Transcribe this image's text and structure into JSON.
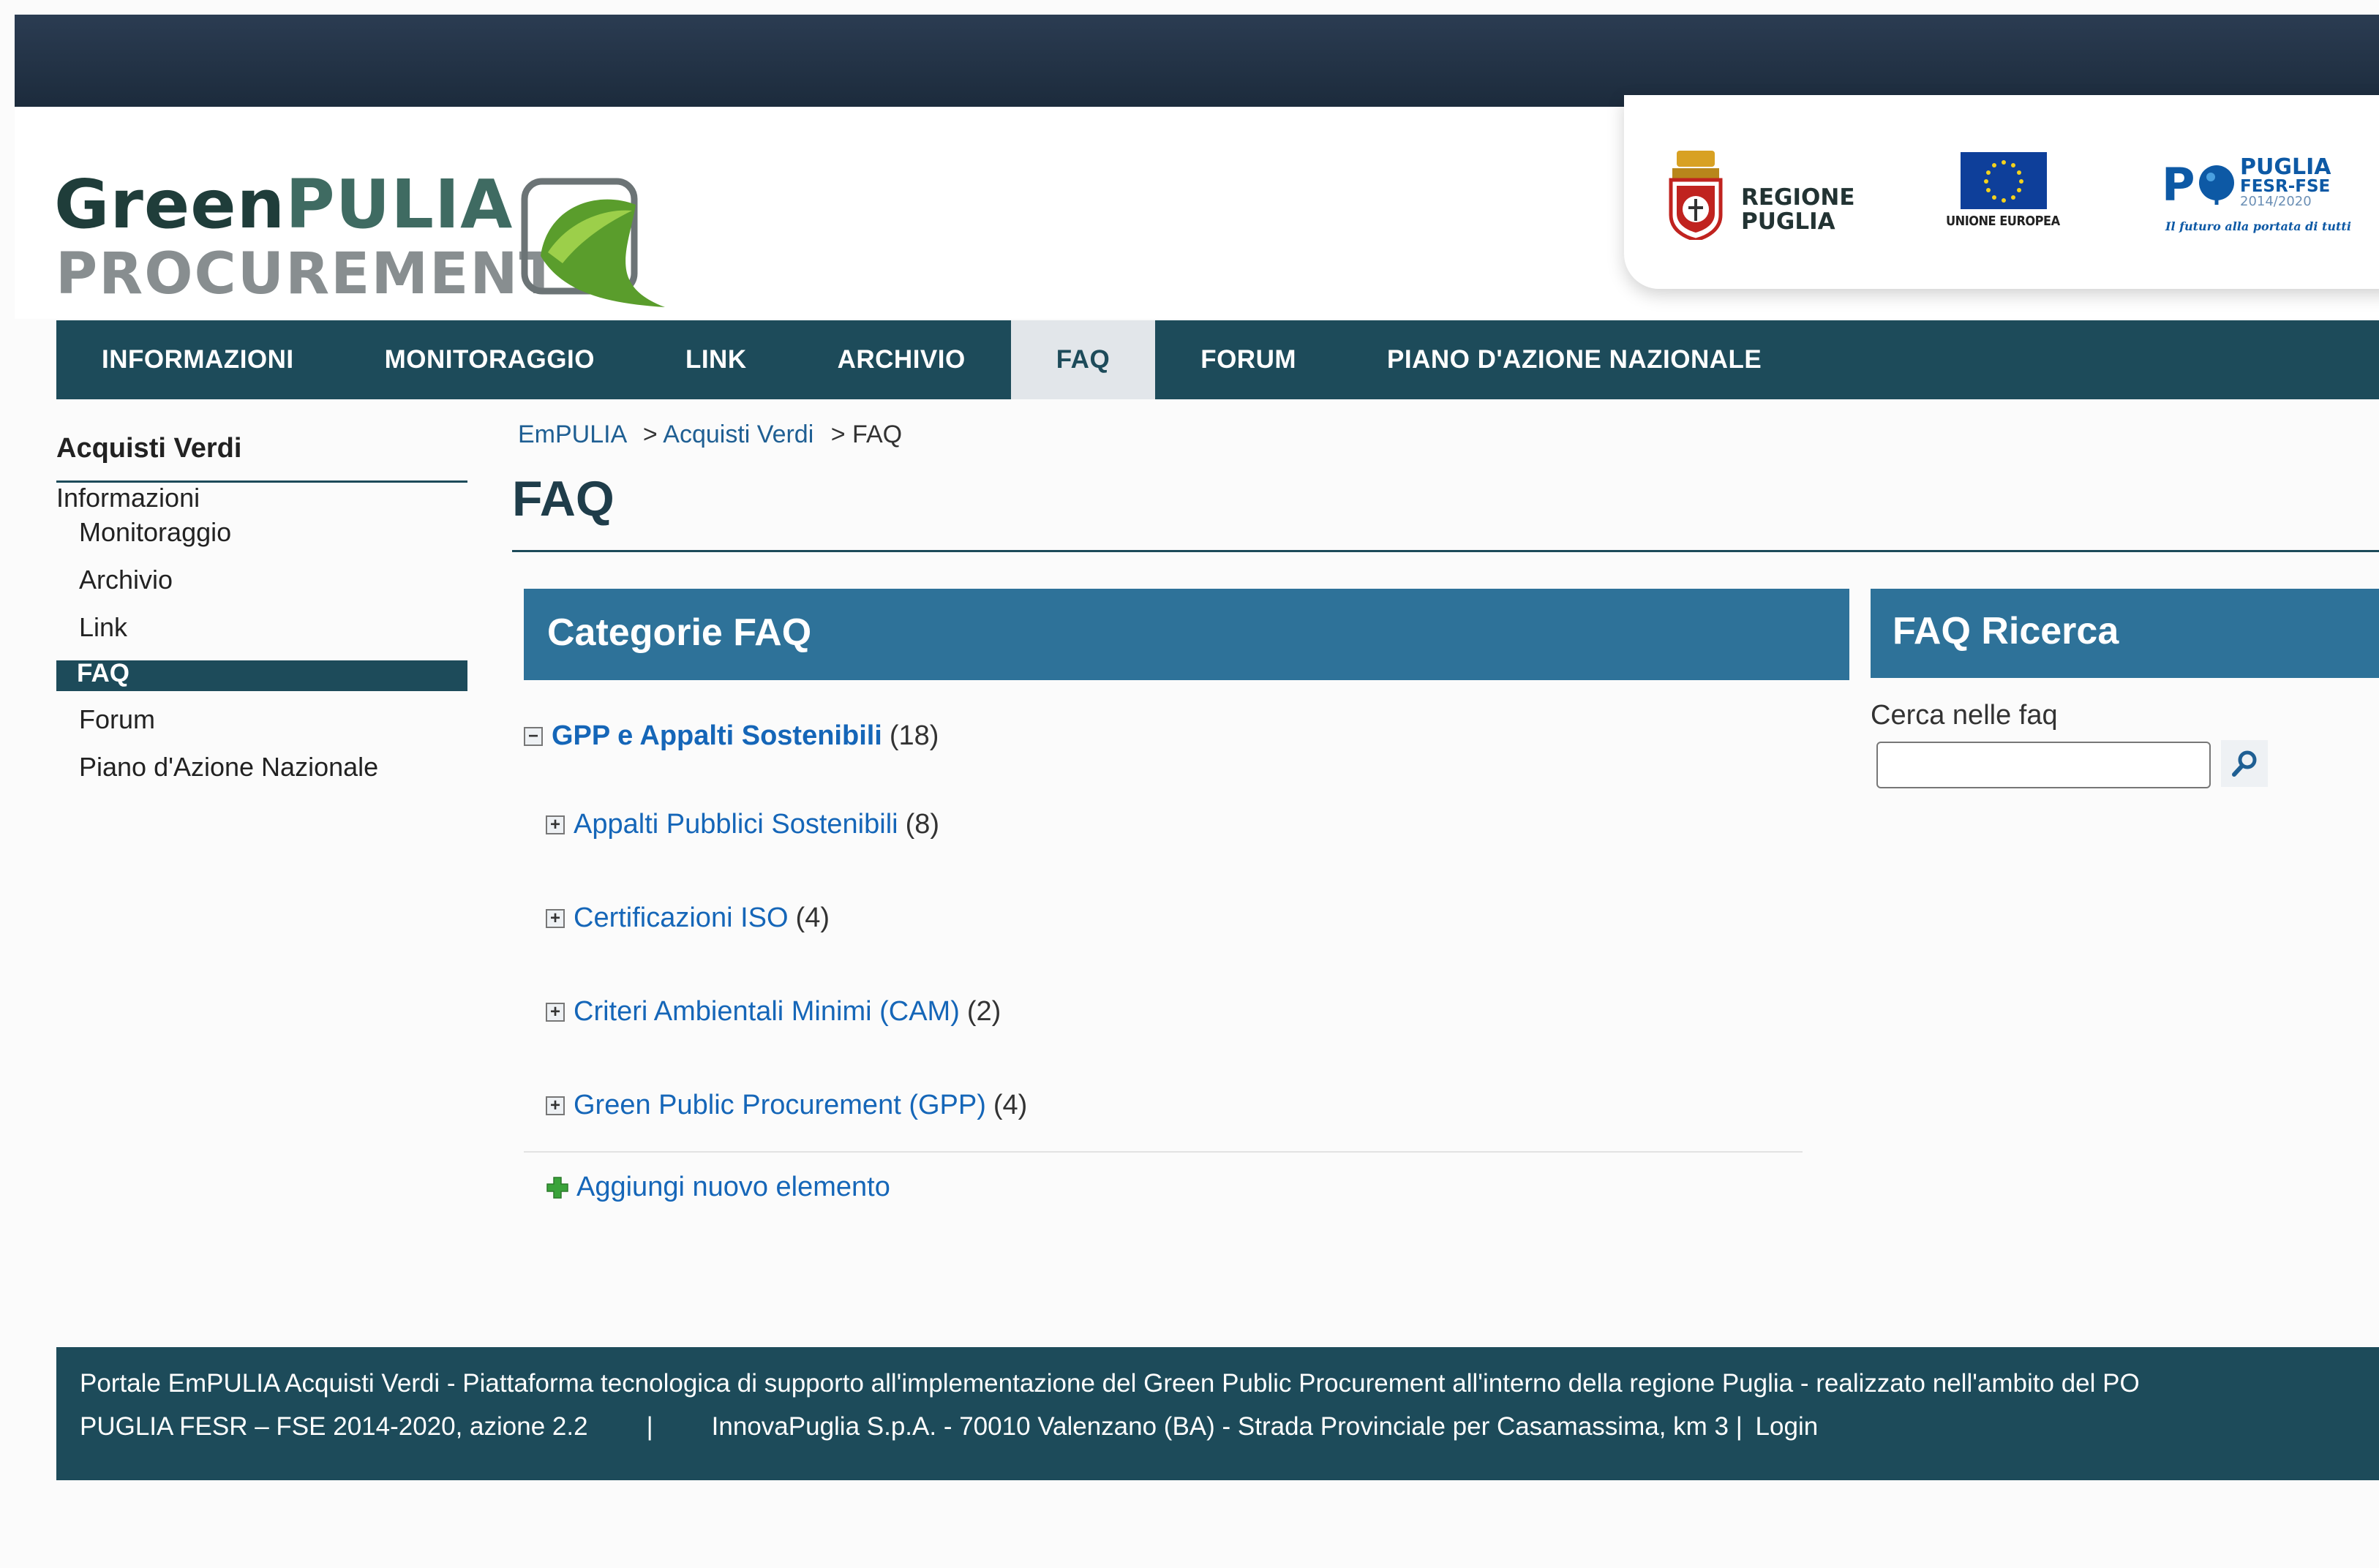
{
  "header": {
    "logo": {
      "line1_a": "Green",
      "line1_b": "PULIA",
      "line2": "PROCUREMENT"
    },
    "partners": {
      "regione": "REGIONE\nPUGLIA",
      "unione_europea": "UNIONE EUROPEA",
      "po_letter": "P",
      "po_line1": "PUGLIA",
      "po_line2": "FESR-FSE",
      "po_line3": "2014/2020",
      "po_tagline": "Il futuro alla portata di tutti"
    }
  },
  "nav": {
    "items": [
      {
        "label": "INFORMAZIONI",
        "active": false
      },
      {
        "label": "MONITORAGGIO",
        "active": false
      },
      {
        "label": "LINK",
        "active": false
      },
      {
        "label": "ARCHIVIO",
        "active": false
      },
      {
        "label": "FAQ",
        "active": true
      },
      {
        "label": "FORUM",
        "active": false
      },
      {
        "label": "PIANO D'AZIONE NAZIONALE",
        "active": false
      }
    ]
  },
  "sidebar": {
    "title": "Acquisti Verdi",
    "top_item": "Informazioni",
    "items": [
      "Monitoraggio",
      "Archivio",
      "Link",
      "FAQ",
      "Forum",
      "Piano d'Azione Nazionale"
    ]
  },
  "breadcrumb": {
    "items": [
      "EmPULIA",
      "Acquisti Verdi",
      "FAQ"
    ],
    "separator": ">"
  },
  "page": {
    "title": "FAQ"
  },
  "categorie": {
    "title": "Categorie FAQ",
    "root": {
      "label": "GPP e Appalti Sostenibili",
      "count": "(18)",
      "toggle": "−"
    },
    "children": [
      {
        "label": "Appalti Pubblici Sostenibili",
        "count": "(8)",
        "toggle": "+"
      },
      {
        "label": "Certificazioni ISO",
        "count": "(4)",
        "toggle": "+"
      },
      {
        "label": "Criteri Ambientali Minimi (CAM)",
        "count": "(2)",
        "toggle": "+"
      },
      {
        "label": "Green Public Procurement (GPP)",
        "count": "(4)",
        "toggle": "+"
      }
    ],
    "add_label": "Aggiungi nuovo elemento"
  },
  "ricerca": {
    "title": "FAQ Ricerca",
    "label": "Cerca nelle faq",
    "value": ""
  },
  "footer": {
    "line1": "Portale EmPULIA Acquisti Verdi - Piattaforma tecnologica di supporto all'implementazione del Green Public Procurement all'interno della regione Puglia - realizzato nell'ambito del PO",
    "line2": "PUGLIA FESR – FSE 2014-2020, azione 2.2",
    "sep": "|",
    "address": "InnovaPuglia S.p.A. - 70010 Valenzano (BA) - Strada Provinciale per Casamassima, km 3 |",
    "login": "Login"
  },
  "colors": {
    "nav_bg": "#1d4b5a",
    "panel_header": "#2e7299",
    "link": "#1566b8",
    "topbar": "#1c2b3c"
  }
}
